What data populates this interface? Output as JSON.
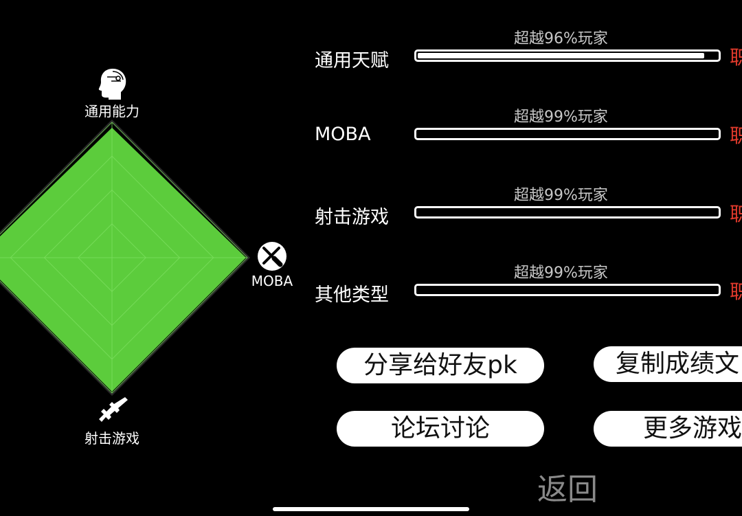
{
  "radar": {
    "axes": [
      {
        "label": "通用能力",
        "icon": "head-profile-icon",
        "value": 0.96
      },
      {
        "label": "MOBA",
        "icon": "crossed-swords-circle-icon",
        "value": 0.99
      },
      {
        "label": "射击游戏",
        "icon": "rifle-icon",
        "value": 0.99
      },
      {
        "label": "其他类型",
        "icon": "",
        "value": 0.99
      }
    ],
    "levels": 4,
    "fill_color": "#5ccc3c",
    "grid_color": "#7ee060"
  },
  "stats": [
    {
      "label": "通用天赋",
      "percent_text": "超越96%玩家",
      "fill": 0.96,
      "rank_text": "职"
    },
    {
      "label": "MOBA",
      "percent_text": "超越99%玩家",
      "fill": 0.0,
      "rank_text": "职"
    },
    {
      "label": "射击游戏",
      "percent_text": "超越99%玩家",
      "fill": 0.0,
      "rank_text": "职"
    },
    {
      "label": "其他类型",
      "percent_text": "超越99%玩家",
      "fill": 0.0,
      "rank_text": "职"
    }
  ],
  "buttons": {
    "share": "分享给好友pk",
    "copy": "复制成绩文",
    "forum": "论坛讨论",
    "more": "更多游戏"
  },
  "back_label": "返回",
  "colors": {
    "accent_red": "#e03a2c",
    "bar_border": "#ffffff"
  }
}
